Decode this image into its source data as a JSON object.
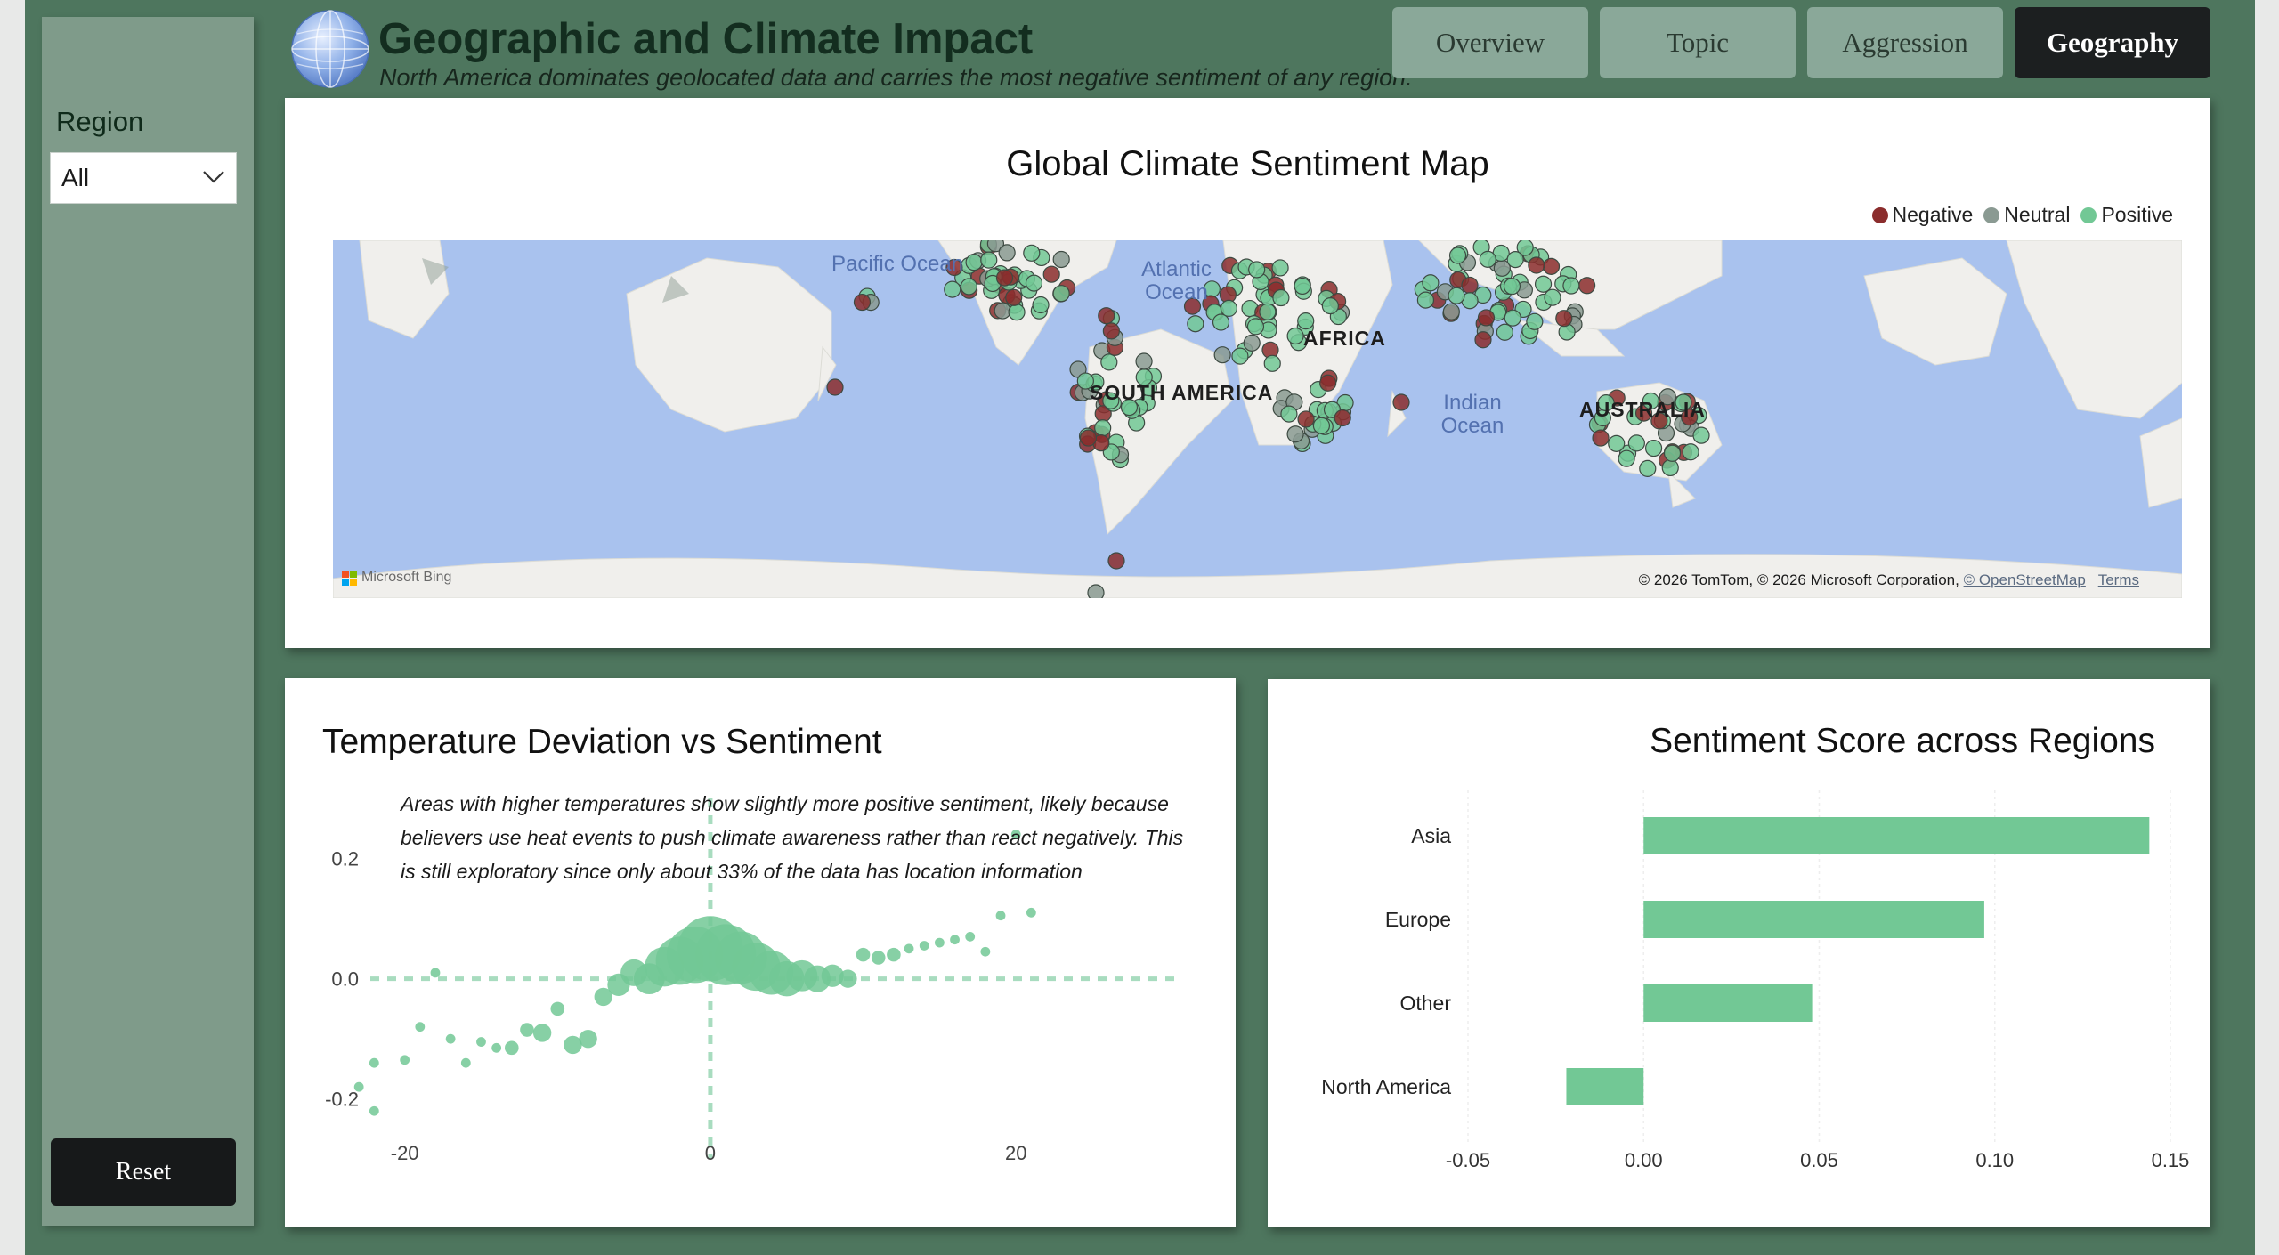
{
  "header": {
    "title": "Geographic and Climate Impact",
    "subtitle": "North America dominates geolocated data and carries the most negative sentiment of any region."
  },
  "tabs": [
    {
      "label": "Overview",
      "active": false
    },
    {
      "label": "Topic",
      "active": false
    },
    {
      "label": "Aggression",
      "active": false
    },
    {
      "label": "Geography",
      "active": true
    }
  ],
  "sidebar": {
    "region_label": "Region",
    "region_value": "All",
    "reset_label": "Reset"
  },
  "map": {
    "title": "Global Climate Sentiment Map",
    "legend": [
      {
        "label": "Negative",
        "color": "#8b2d2d"
      },
      {
        "label": "Neutral",
        "color": "#8a9a92"
      },
      {
        "label": "Positive",
        "color": "#72c895"
      }
    ],
    "ocean_labels": {
      "pacific": "Pacific Ocean",
      "atlantic": "Atlantic Ocean",
      "indian": "Indian Ocean"
    },
    "continent_labels": {
      "south_america": "SOUTH AMERICA",
      "africa": "AFRICA",
      "australia": "AUSTRALIA"
    },
    "attribution": "Microsoft Bing",
    "copyright": "© 2026 TomTom, © 2026 Microsoft Corporation,",
    "osm_link": "© OpenStreetMap",
    "terms_link": "Terms"
  },
  "scatter": {
    "title": "Temperature Deviation vs Sentiment",
    "annotation": "Areas with higher temperatures show slightly more positive sentiment, likely because believers use heat events to push climate awareness rather than react negatively. This is still exploratory since only about 33% of the data has location information"
  },
  "bars": {
    "title": "Sentiment Score across Regions"
  },
  "colors": {
    "background": "#4e765e",
    "sidebar": "#7f9b8a",
    "accent": "#72c895",
    "negative": "#8b2d2d"
  },
  "chart_data": [
    {
      "type": "scatter",
      "title": "Temperature Deviation vs Sentiment",
      "x_ticks": [
        -20,
        0,
        20
      ],
      "y_ticks": [
        0.2,
        0.0,
        -0.2
      ],
      "xlim": [
        -24,
        31
      ],
      "ylim": [
        -0.27,
        0.3
      ],
      "reference_lines": {
        "x": 0,
        "y": 0
      },
      "points": [
        {
          "x": -23,
          "y": -0.18,
          "size": 1
        },
        {
          "x": -22,
          "y": -0.22,
          "size": 1
        },
        {
          "x": -22,
          "y": -0.14,
          "size": 1
        },
        {
          "x": -20,
          "y": -0.135,
          "size": 1
        },
        {
          "x": -19,
          "y": -0.08,
          "size": 1
        },
        {
          "x": -18,
          "y": 0.01,
          "size": 1
        },
        {
          "x": -17,
          "y": -0.1,
          "size": 1
        },
        {
          "x": -16,
          "y": -0.14,
          "size": 1
        },
        {
          "x": -15,
          "y": -0.105,
          "size": 1
        },
        {
          "x": -14,
          "y": -0.115,
          "size": 1
        },
        {
          "x": -13,
          "y": -0.115,
          "size": 2
        },
        {
          "x": -12,
          "y": -0.085,
          "size": 2
        },
        {
          "x": -11,
          "y": -0.09,
          "size": 3
        },
        {
          "x": -10,
          "y": -0.05,
          "size": 2
        },
        {
          "x": -9,
          "y": -0.11,
          "size": 3
        },
        {
          "x": -8,
          "y": -0.1,
          "size": 3
        },
        {
          "x": -7,
          "y": -0.03,
          "size": 3
        },
        {
          "x": -6,
          "y": -0.01,
          "size": 4
        },
        {
          "x": -5,
          "y": 0.01,
          "size": 5
        },
        {
          "x": -4,
          "y": 0.0,
          "size": 6
        },
        {
          "x": -3,
          "y": 0.02,
          "size": 8
        },
        {
          "x": -2,
          "y": 0.03,
          "size": 10
        },
        {
          "x": -1,
          "y": 0.04,
          "size": 12
        },
        {
          "x": 0,
          "y": 0.05,
          "size": 14
        },
        {
          "x": 1,
          "y": 0.04,
          "size": 13
        },
        {
          "x": 2,
          "y": 0.035,
          "size": 11
        },
        {
          "x": 3,
          "y": 0.02,
          "size": 10
        },
        {
          "x": 4,
          "y": 0.01,
          "size": 9
        },
        {
          "x": 5,
          "y": 0.0,
          "size": 7
        },
        {
          "x": 6,
          "y": 0.005,
          "size": 6
        },
        {
          "x": 7,
          "y": 0.0,
          "size": 5
        },
        {
          "x": 8,
          "y": 0.005,
          "size": 4
        },
        {
          "x": 9,
          "y": 0.0,
          "size": 3
        },
        {
          "x": 10,
          "y": 0.04,
          "size": 2
        },
        {
          "x": 11,
          "y": 0.035,
          "size": 2
        },
        {
          "x": 12,
          "y": 0.04,
          "size": 2
        },
        {
          "x": 13,
          "y": 0.05,
          "size": 1
        },
        {
          "x": 14,
          "y": 0.055,
          "size": 1
        },
        {
          "x": 15,
          "y": 0.06,
          "size": 1
        },
        {
          "x": 16,
          "y": 0.065,
          "size": 1
        },
        {
          "x": 17,
          "y": 0.07,
          "size": 1
        },
        {
          "x": 18,
          "y": 0.045,
          "size": 1
        },
        {
          "x": 19,
          "y": 0.105,
          "size": 1
        },
        {
          "x": 20,
          "y": 0.24,
          "size": 1
        },
        {
          "x": 21,
          "y": 0.11,
          "size": 1
        }
      ]
    },
    {
      "type": "bar",
      "orientation": "horizontal",
      "title": "Sentiment Score across Regions",
      "categories": [
        "Asia",
        "Europe",
        "Other",
        "North America"
      ],
      "values": [
        0.144,
        0.097,
        0.048,
        -0.022
      ],
      "x_ticks": [
        -0.05,
        0.0,
        0.05,
        0.1,
        0.15
      ],
      "xlim": [
        -0.05,
        0.15
      ],
      "color": "#72c895"
    }
  ]
}
